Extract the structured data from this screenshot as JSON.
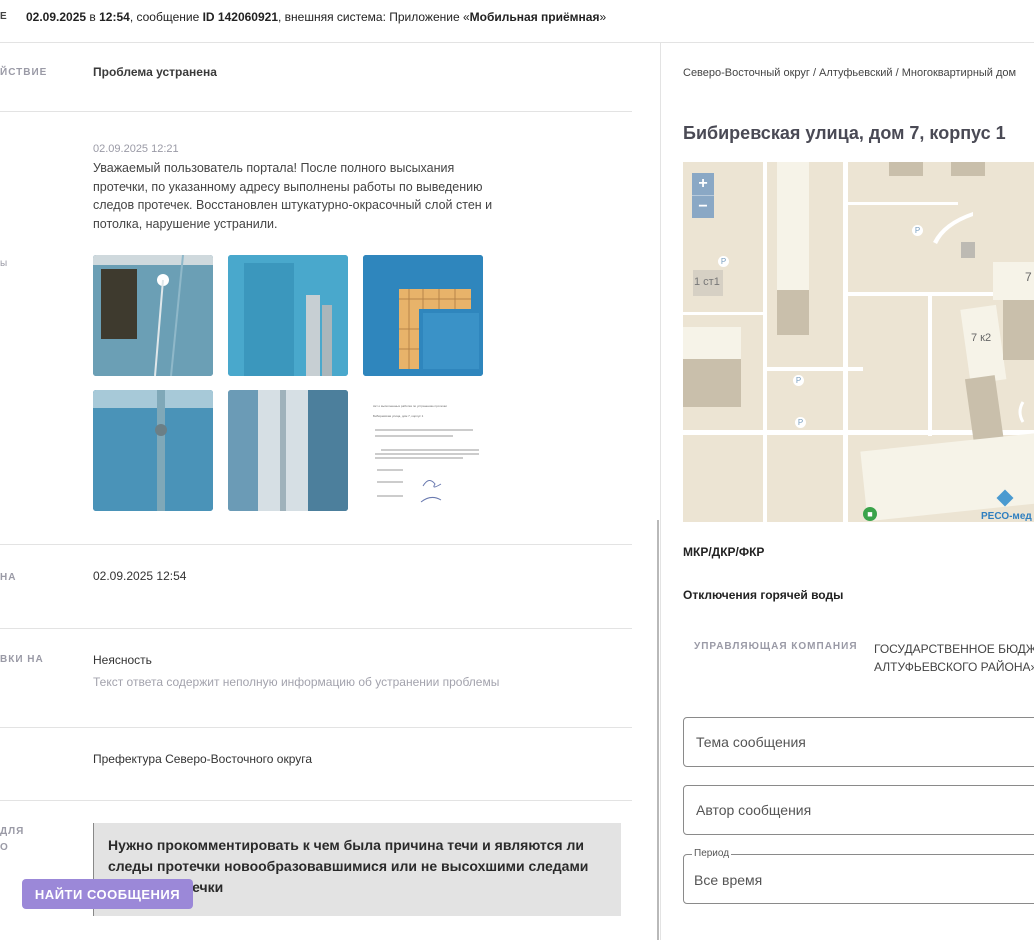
{
  "header": {
    "label": "Е",
    "date": "02.09.2025",
    "in": " в ",
    "time": "12:54",
    "msg_text": ", сообщение ",
    "msg_id": "ID 142060921",
    "ext_text": ", внешняя система: Приложение «",
    "app_name": "Мобильная приёмная",
    "close": "»"
  },
  "details": {
    "action_label": "ЙСТВИЕ",
    "action_value": "Проблема устранена",
    "files_label": "ы",
    "reply_date": "02.09.2025 12:21",
    "reply_text": "Уважаемый пользователь портала! После полного высыхания протечки, по указанному адресу выполнены работы по выведению следов протечек. Восстановлен штукатурно-окрасочный слой стен и потолка, нарушение устранили.",
    "deadline_label": "НА",
    "deadline_value": "02.09.2025 12:54",
    "reason_label": "ВКИ НА",
    "reason_value": "Неясность",
    "reason_note": "Текст ответа содержит неполную информацию об устранении проблемы",
    "org_value": "Префектура Северо-Восточного округа",
    "comment_label_1": "ДЛЯ",
    "comment_label_2": "О",
    "comment_text": "Нужно прокомментировать к чем была причина течи и являются ли следы протечки новообразовавшимися или не высохшими следами старой протечки"
  },
  "document_thumb": {
    "line1": "Акт о выполненных работах по устранению протечки",
    "line2": "Бибиревская улица, дом 7, корпус 1"
  },
  "right": {
    "breadcrumb": "Северо-Восточный округ / Алтуфьевский / Многоквартирный дом",
    "address": "Бибиревская улица, дом 7, корпус 1",
    "map_labels": {
      "building_1": "1 ст1",
      "building_2": "7 к2",
      "building_3": "7",
      "parking": "P",
      "zoom_in": "+",
      "zoom_out": "−",
      "attribution": "РЕСО-мед"
    },
    "mkr": "МКР/ДКР/ФКР",
    "outage": "Отключения горячей воды",
    "mc_label": "УПРАВЛЯЮЩАЯ КОМПАНИЯ",
    "mc_value": "ГОСУДАРСТВЕННОЕ БЮДЖ АЛТУФЬЕВСКОГО РАЙОНА»",
    "topic_placeholder": "Тема сообщения",
    "author_placeholder": "Автор сообщения",
    "period_legend": "Период",
    "period_value": "Все время",
    "search_button": "НАЙТИ СООБЩЕНИЯ"
  }
}
